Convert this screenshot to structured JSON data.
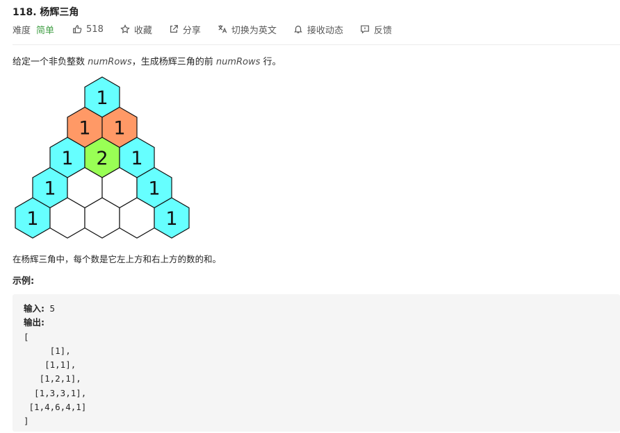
{
  "problem": {
    "title": "118. 杨辉三角"
  },
  "meta": {
    "difficulty_label": "难度",
    "difficulty_value": "简单",
    "likes": "518",
    "collect": "收藏",
    "share": "分享",
    "switch_lang": "切换为英文",
    "notify": "接收动态",
    "feedback": "反馈",
    "colors": {
      "easy": "#43a047"
    }
  },
  "description": {
    "prefix": "给定一个非负整数 ",
    "var1": "numRows",
    "middle": "，生成杨辉三角的前 ",
    "var2": "numRows",
    "suffix": " 行。"
  },
  "figure": {
    "rows": [
      [
        "1"
      ],
      [
        "1",
        "1"
      ],
      [
        "1",
        "2",
        "1"
      ],
      [
        "1",
        "",
        "",
        "1"
      ],
      [
        "1",
        "",
        "",
        "",
        "1"
      ]
    ],
    "colors": {
      "cyan": "#66ffff",
      "orange": "#ff9966",
      "green": "#99ff55",
      "white": "#ffffff"
    }
  },
  "note": "在杨辉三角中，每个数是它左上方和右上方的数的和。",
  "example": {
    "title": "示例:",
    "input_label": "输入:",
    "input_value": " 5",
    "output_label": "输出:",
    "output_lines": [
      "[",
      "     [1],",
      "    [1,1],",
      "   [1,2,1],",
      "  [1,3,3,1],",
      " [1,4,6,4,1]",
      "]"
    ]
  }
}
